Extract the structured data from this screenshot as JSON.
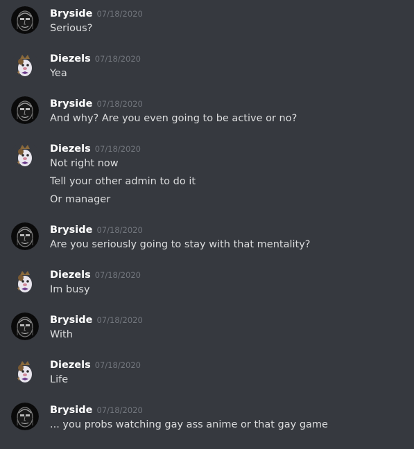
{
  "messages": [
    {
      "author": "Bryside",
      "avatar": "bryside-avatar",
      "timestamp": "07/18/2020",
      "lines": [
        "Serious?"
      ]
    },
    {
      "author": "Diezels",
      "avatar": "diezels-avatar",
      "timestamp": "07/18/2020",
      "lines": [
        "Yea"
      ]
    },
    {
      "author": "Bryside",
      "avatar": "bryside-avatar",
      "timestamp": "07/18/2020",
      "lines": [
        "And why? Are you even going to be active or no?"
      ]
    },
    {
      "author": "Diezels",
      "avatar": "diezels-avatar",
      "timestamp": "07/18/2020",
      "lines": [
        "Not right now",
        "Tell your other admin to do it",
        "Or manager"
      ]
    },
    {
      "author": "Bryside",
      "avatar": "bryside-avatar",
      "timestamp": "07/18/2020",
      "lines": [
        "Are you seriously going to stay with that mentality?"
      ]
    },
    {
      "author": "Diezels",
      "avatar": "diezels-avatar",
      "timestamp": "07/18/2020",
      "lines": [
        "Im busy"
      ]
    },
    {
      "author": "Bryside",
      "avatar": "bryside-avatar",
      "timestamp": "07/18/2020",
      "lines": [
        "With"
      ]
    },
    {
      "author": "Diezels",
      "avatar": "diezels-avatar",
      "timestamp": "07/18/2020",
      "lines": [
        "Life"
      ]
    },
    {
      "author": "Bryside",
      "avatar": "bryside-avatar",
      "timestamp": "07/18/2020",
      "lines": [
        "... you probs watching gay ass anime or that gay game"
      ]
    }
  ],
  "colors": {
    "background": "#36393f",
    "author": "#ffffff",
    "timestamp": "#72767d",
    "text": "#dcddde"
  }
}
